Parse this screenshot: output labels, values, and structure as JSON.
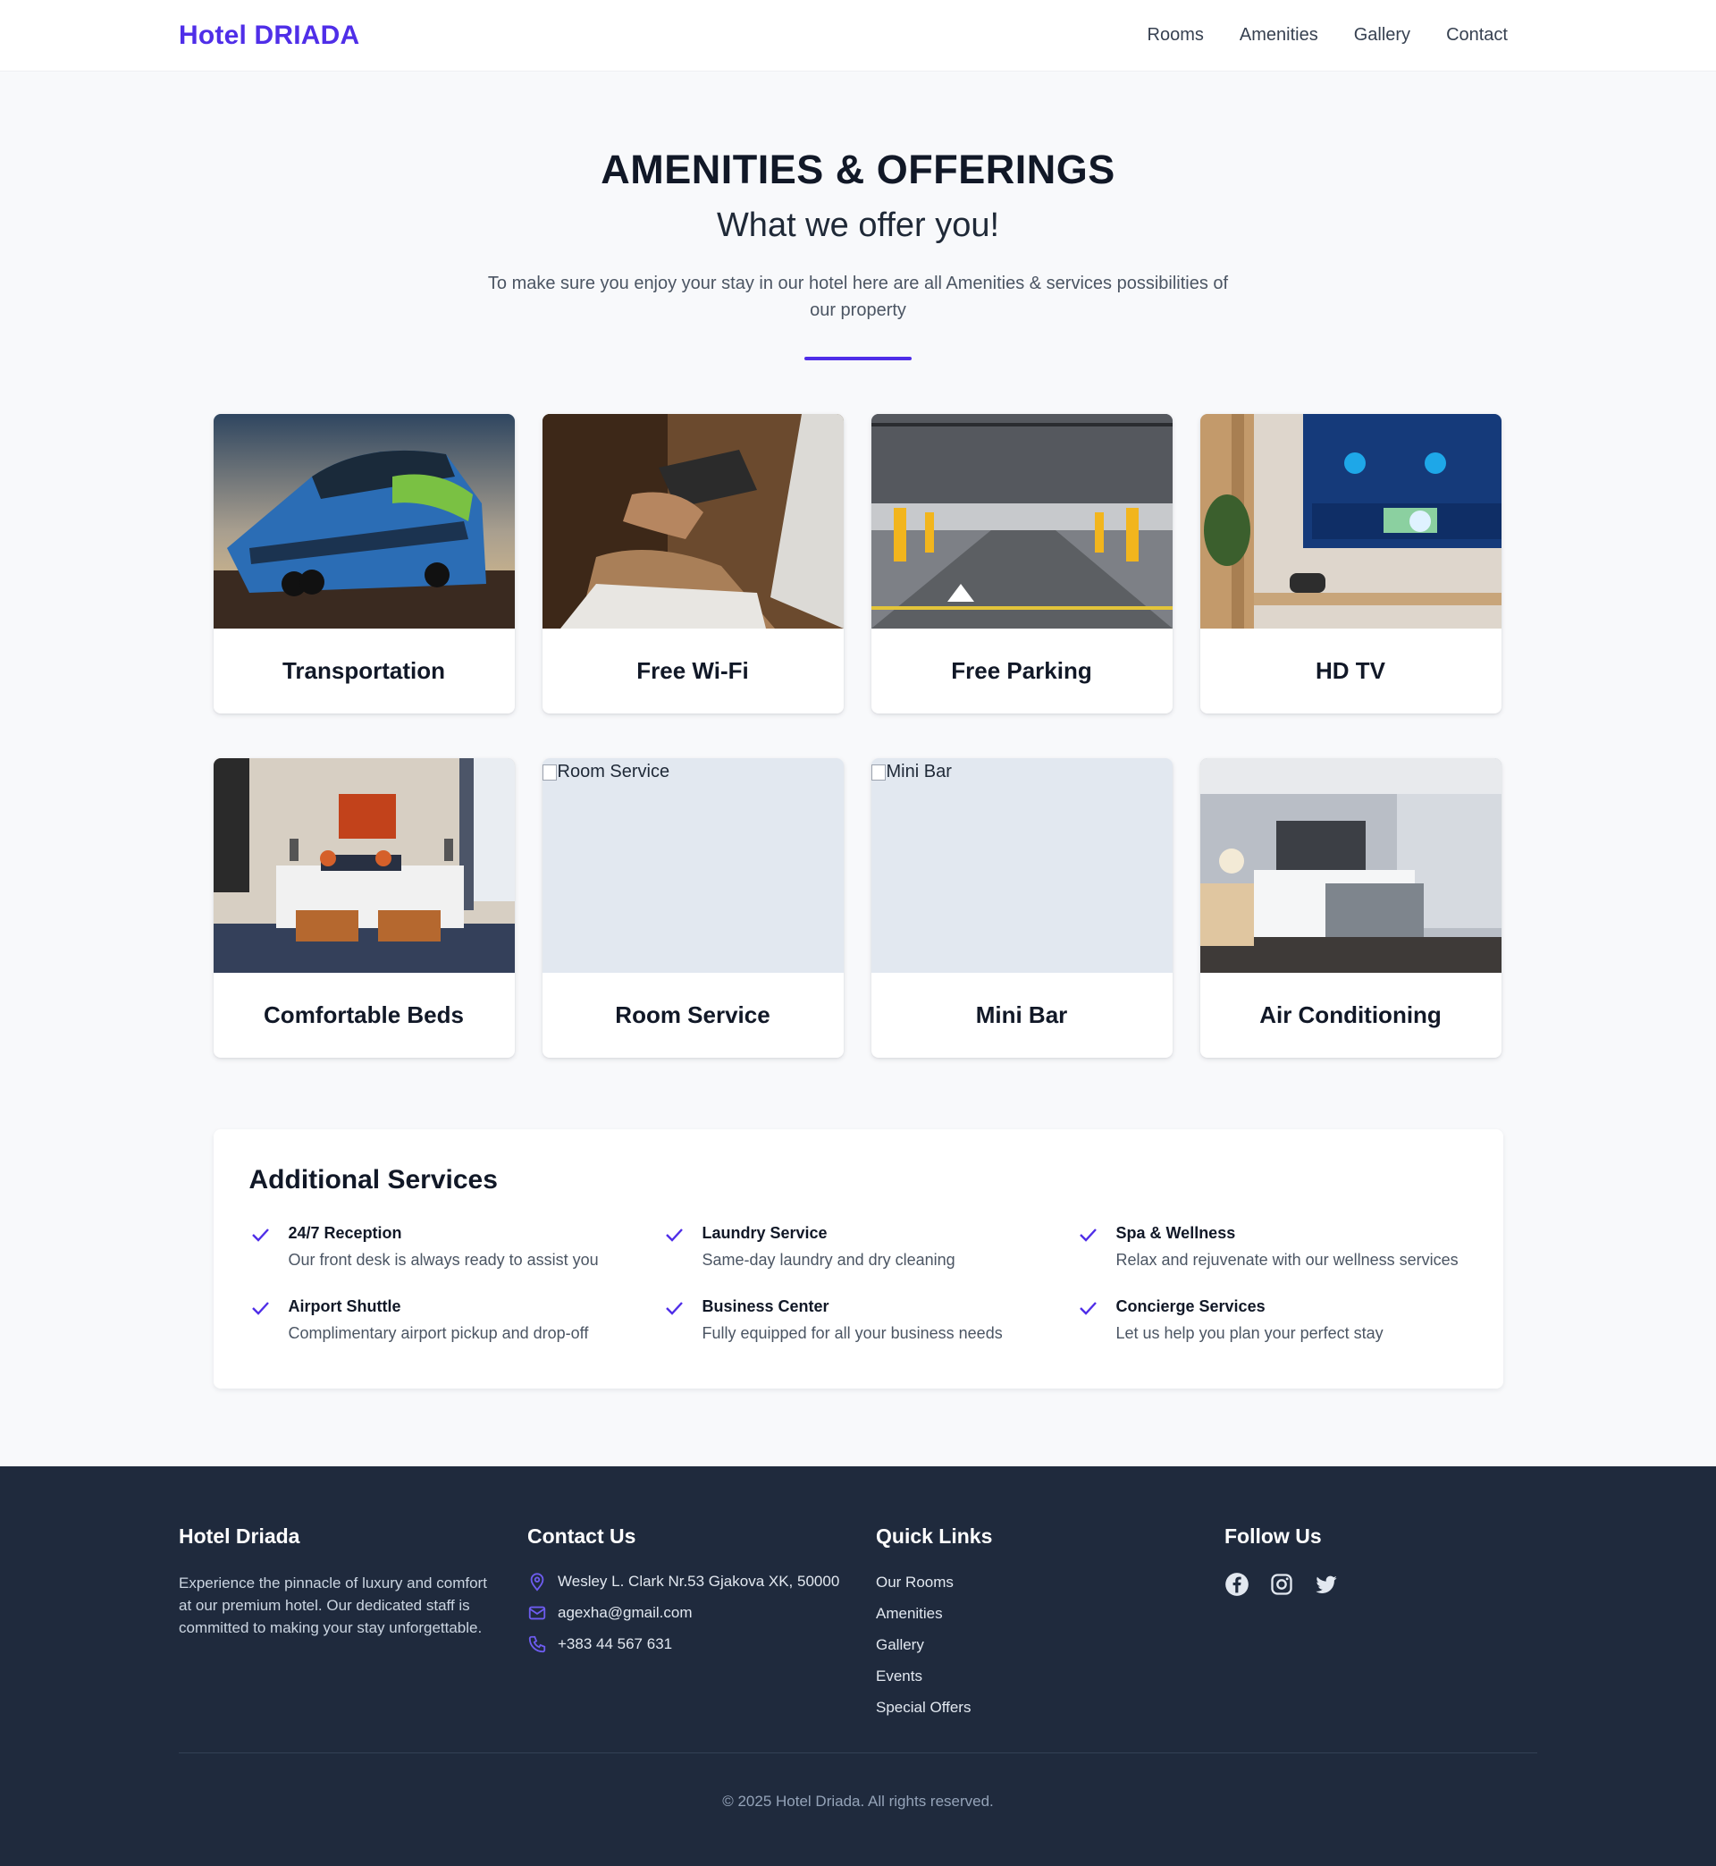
{
  "header": {
    "brand": "Hotel DRIADA",
    "nav": [
      "Rooms",
      "Amenities",
      "Gallery",
      "Contact"
    ]
  },
  "intro": {
    "title": "AMENITIES & OFFERINGS",
    "subtitle": "What we offer you!",
    "description": "To make sure you enjoy your stay in our hotel here are all Amenities & services possibilities of our property"
  },
  "amenities": [
    {
      "title": "Transportation",
      "image": "bus-photo"
    },
    {
      "title": "Free Wi-Fi",
      "image": "laptop-card-photo"
    },
    {
      "title": "Free Parking",
      "image": "parking-garage-photo"
    },
    {
      "title": "HD TV",
      "image": "smart-tv-photo"
    },
    {
      "title": "Comfortable Beds",
      "image": "bedroom-photo"
    },
    {
      "title": "Room Service",
      "image_alt": "Room Service"
    },
    {
      "title": "Mini Bar",
      "image_alt": "Mini Bar"
    },
    {
      "title": "Air Conditioning",
      "image": "hotel-room-photo"
    }
  ],
  "services": {
    "title": "Additional Services",
    "items": [
      {
        "name": "24/7 Reception",
        "desc": "Our front desk is always ready to assist you"
      },
      {
        "name": "Laundry Service",
        "desc": "Same-day laundry and dry cleaning"
      },
      {
        "name": "Spa & Wellness",
        "desc": "Relax and rejuvenate with our wellness services"
      },
      {
        "name": "Airport Shuttle",
        "desc": "Complimentary airport pickup and drop-off"
      },
      {
        "name": "Business Center",
        "desc": "Fully equipped for all your business needs"
      },
      {
        "name": "Concierge Services",
        "desc": "Let us help you plan your perfect stay"
      }
    ]
  },
  "footer": {
    "about_title": "Hotel Driada",
    "about_text": "Experience the pinnacle of luxury and comfort at our premium hotel. Our dedicated staff is committed to making your stay unforgettable.",
    "contact_title": "Contact Us",
    "address": "Wesley L. Clark Nr.53 Gjakova XK, 50000",
    "email": "agexha@gmail.com",
    "phone": "+383 44 567 631",
    "links_title": "Quick Links",
    "links": [
      "Our Rooms",
      "Amenities",
      "Gallery",
      "Events",
      "Special Offers"
    ],
    "follow_title": "Follow Us",
    "social": [
      "facebook-icon",
      "instagram-icon",
      "twitter-icon"
    ],
    "copyright": "© 2025 Hotel Driada. All rights reserved."
  },
  "colors": {
    "accent": "#4f2ee8",
    "footer_bg": "#1f2a3d",
    "page_bg": "#f8f9fb"
  }
}
